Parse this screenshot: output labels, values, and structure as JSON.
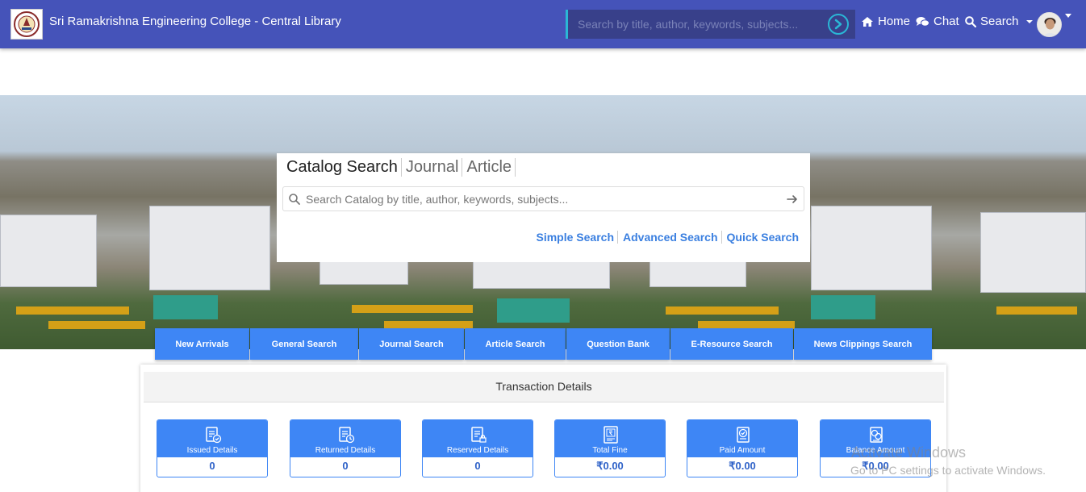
{
  "navbar": {
    "brand": "Sri Ramakrishna Engineering College - Central Library",
    "search_placeholder": "Search by title, author, keywords, subjects...",
    "links": {
      "home": "Home",
      "chat": "Chat",
      "search": "Search"
    }
  },
  "catalog": {
    "tabs": [
      "Catalog Search",
      "Journal",
      "Article"
    ],
    "search_placeholder": "Search Catalog by title, author, keywords, subjects...",
    "modes": [
      "Simple Search",
      "Advanced Search",
      "Quick Search"
    ]
  },
  "quick_buttons": [
    "New Arrivals",
    "General Search",
    "Journal Search",
    "Article Search",
    "Question Bank",
    "E-Resource Search",
    "News Clippings Search"
  ],
  "transactions": {
    "title": "Transaction Details",
    "cards": [
      {
        "label": "Issued Details",
        "value": "0",
        "icon": "issued-icon"
      },
      {
        "label": "Returned Details",
        "value": "0",
        "icon": "returned-icon"
      },
      {
        "label": "Reserved Details",
        "value": "0",
        "icon": "reserved-icon"
      },
      {
        "label": "Total Fine",
        "value": "₹0.00",
        "icon": "fine-icon"
      },
      {
        "label": "Paid Amount",
        "value": "₹0.00",
        "icon": "paid-icon"
      },
      {
        "label": "Balance Amount",
        "value": "₹0.00",
        "icon": "balance-icon"
      }
    ]
  },
  "watermark": {
    "line1": "Activate Windows",
    "line2": "Go to PC settings to activate Windows."
  },
  "colors": {
    "navbar": "#4553b9",
    "accent": "#3e86f5",
    "link": "#3a7fe0"
  }
}
